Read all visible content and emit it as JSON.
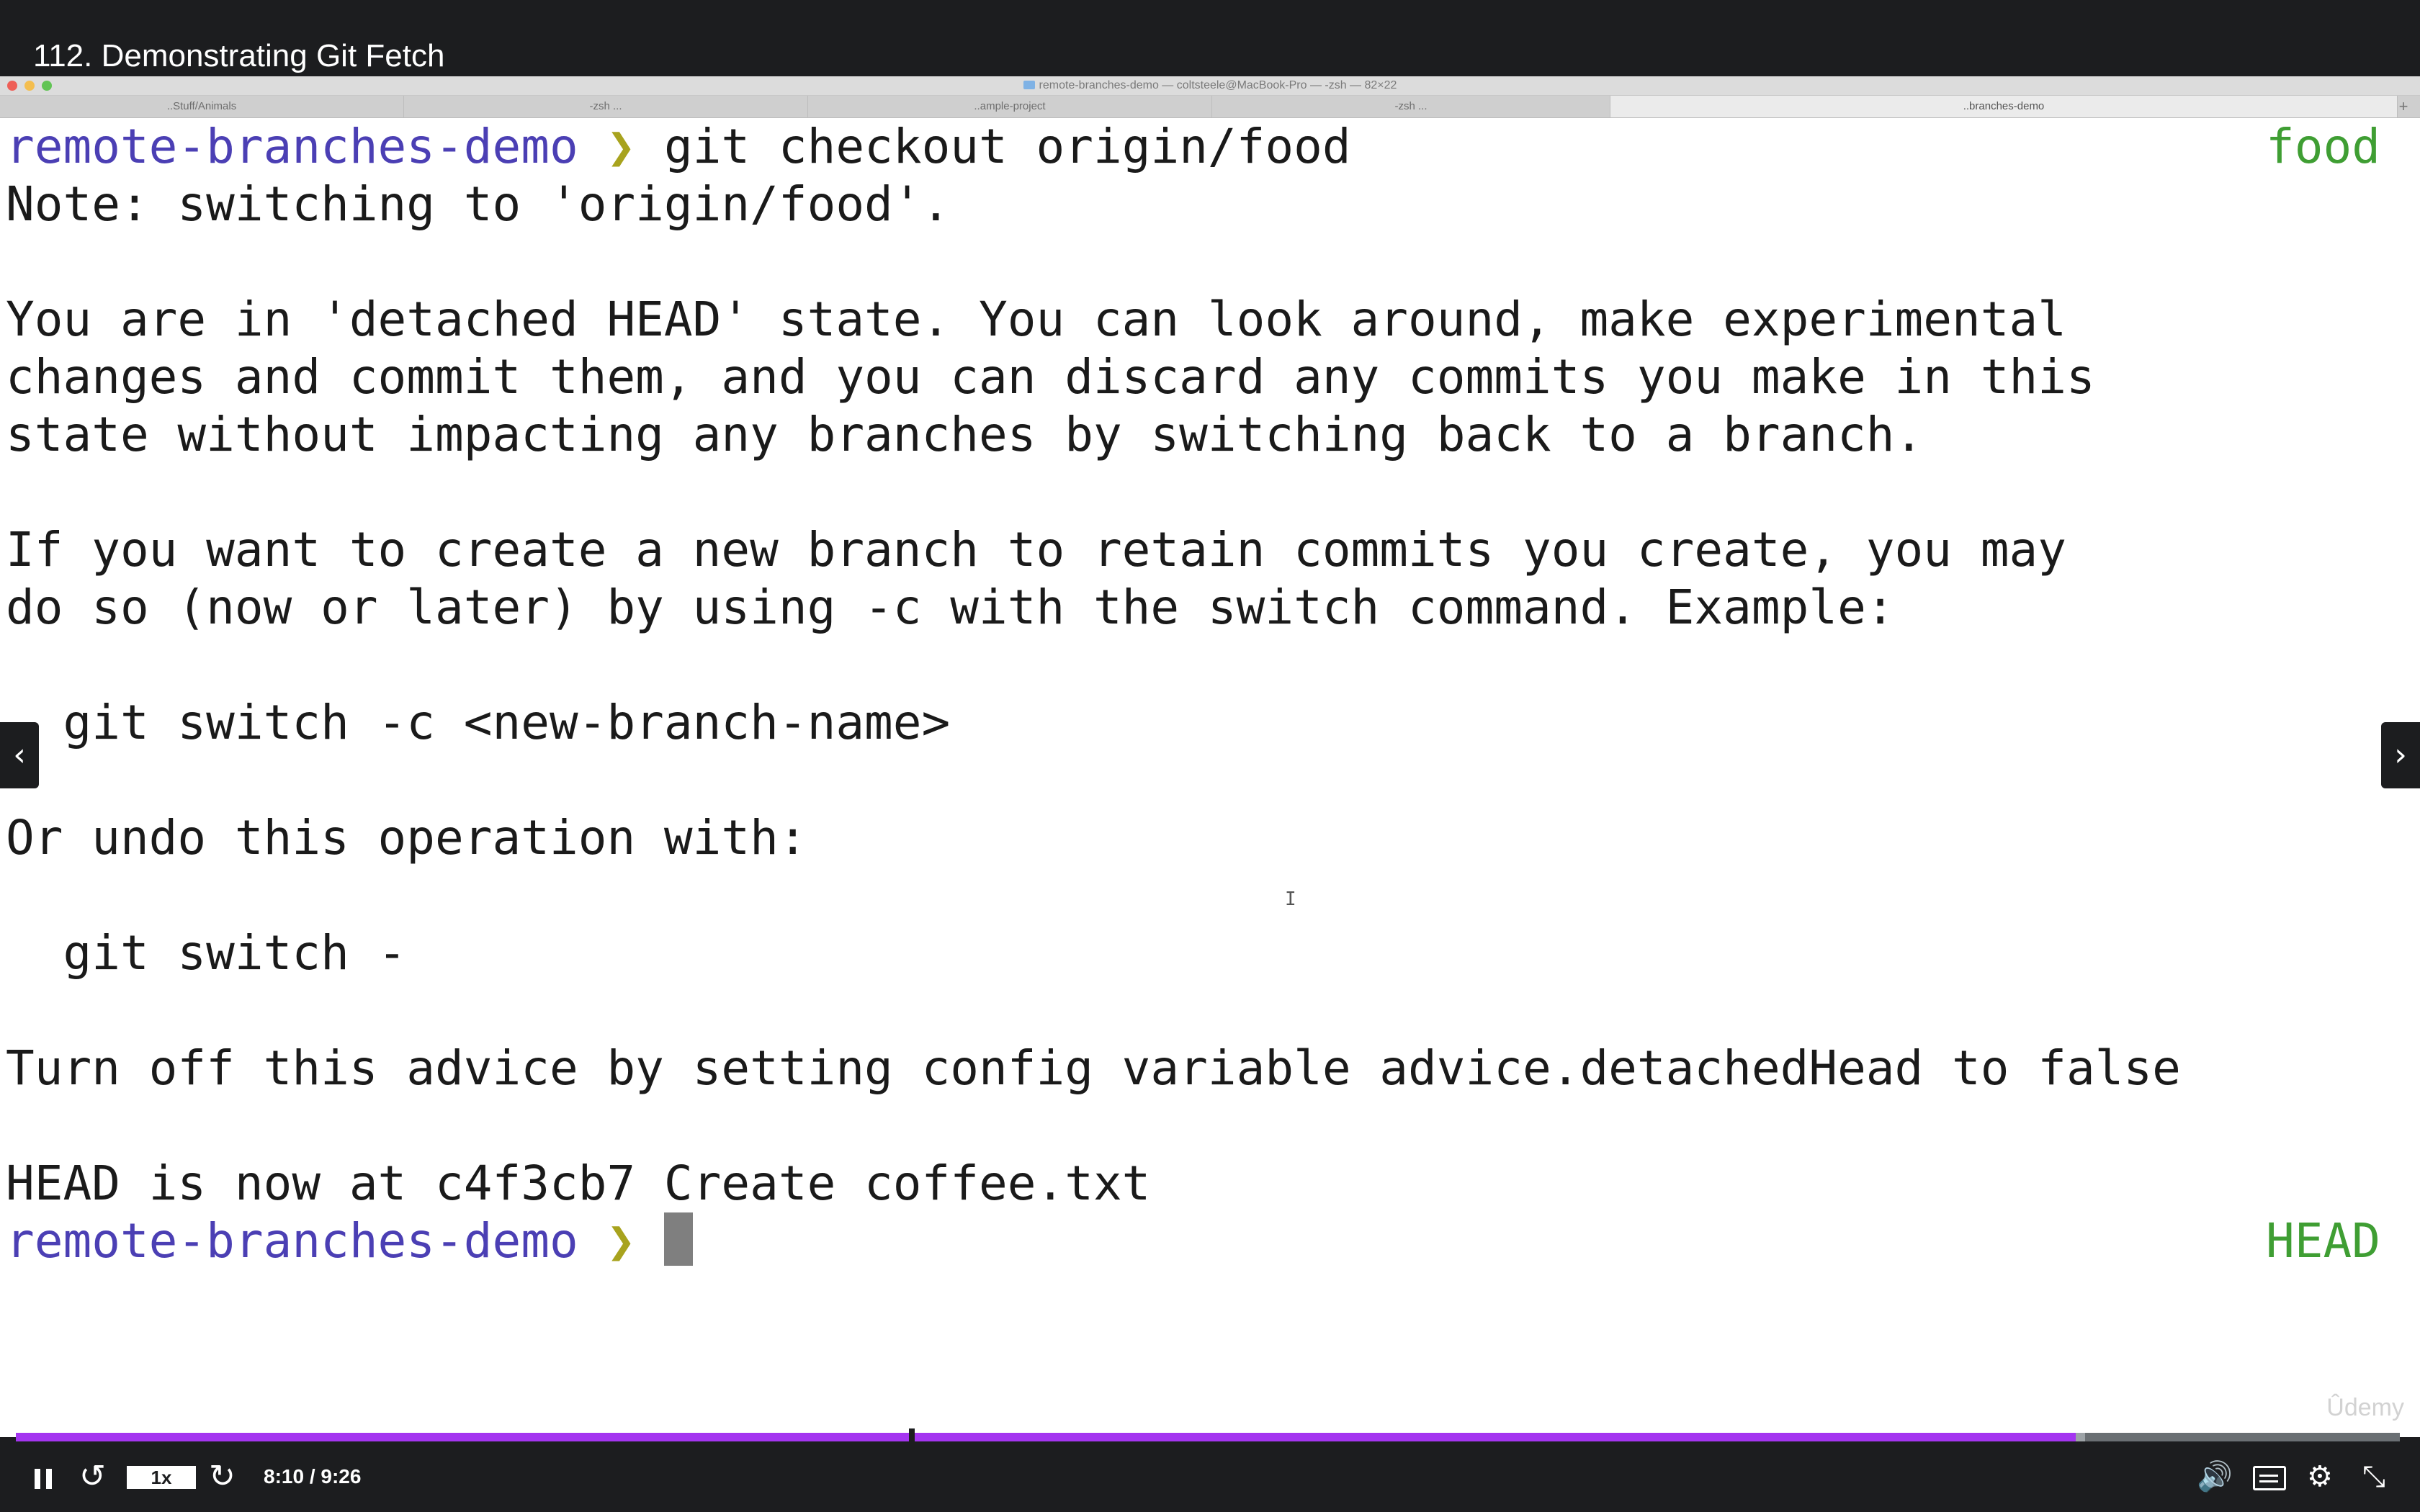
{
  "video": {
    "lecture_title": "112. Demonstrating Git Fetch",
    "watermark": "Ûdemy",
    "playback_speed": "1x",
    "current_time": "8:10",
    "duration": "9:26",
    "timecode": "8:10 / 9:26",
    "progress_fraction": 0.864,
    "buffered_fraction": 0.868,
    "accent_color": "#a435f0",
    "icons": {
      "play_pause": "pause-icon",
      "rewind": "rewind-5-icon",
      "forward": "forward-5-icon",
      "volume": "volume-icon",
      "captions": "captions-icon",
      "settings": "gear-icon",
      "fullscreen": "exit-fullscreen-icon",
      "prev": "chevron-left-icon",
      "next": "chevron-right-icon"
    },
    "prev_glyph": "‹",
    "next_glyph": "›"
  },
  "terminal_window": {
    "title": "remote-branches-demo — coltsteele@MacBook-Pro — -zsh — 82×22",
    "tabs": [
      {
        "label": "..Stuff/Animals",
        "active": false
      },
      {
        "label": "-zsh ...",
        "active": false
      },
      {
        "label": "..ample-project",
        "active": false
      },
      {
        "label": "-zsh ...",
        "active": false
      },
      {
        "label": "..branches-demo",
        "active": true
      }
    ],
    "new_tab_glyph": "+"
  },
  "terminal": {
    "prompt_dir": "remote-branches-demo",
    "prompt_arrow": "❯",
    "command": " git checkout origin/food",
    "rprompt_first": "food",
    "rprompt_last": "HEAD",
    "output": [
      "Note: switching to 'origin/food'.",
      "",
      "You are in 'detached HEAD' state. You can look around, make experimental",
      "changes and commit them, and you can discard any commits you make in this",
      "state without impacting any branches by switching back to a branch.",
      "",
      "If you want to create a new branch to retain commits you create, you may",
      "do so (now or later) by using -c with the switch command. Example:",
      "",
      "  git switch -c <new-branch-name>",
      "",
      "Or undo this operation with:",
      "",
      "  git switch -",
      "",
      "Turn off this advice by setting config variable advice.detachedHead to false",
      "",
      "HEAD is now at c4f3cb7 Create coffee.txt"
    ]
  }
}
